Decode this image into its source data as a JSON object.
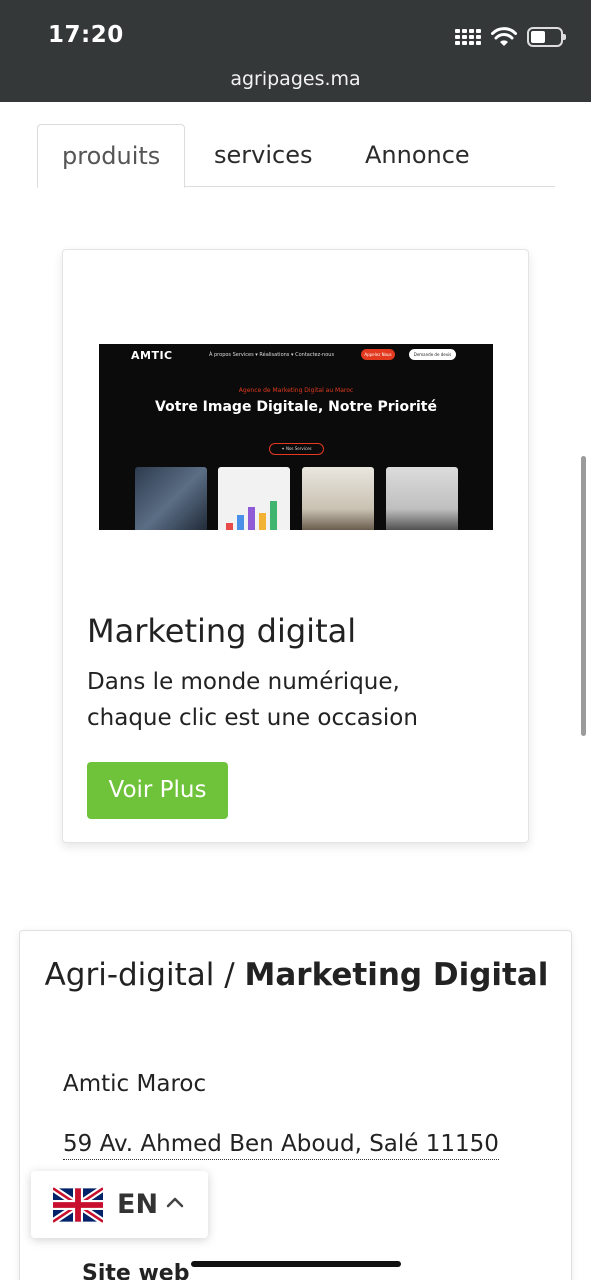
{
  "status_bar": {
    "time": "17:20",
    "url": "agripages.ma"
  },
  "tabs": [
    {
      "label": "produits",
      "active": true
    },
    {
      "label": "services",
      "active": false
    },
    {
      "label": "Annonce",
      "active": false
    }
  ],
  "product_card": {
    "thumbnail": {
      "logo": "AMTIC",
      "nav": "À propos   Services ▾   Réalisations ▾   Contactez-nous",
      "btn_call": "Appelez Nous",
      "btn_quote": "Demande de devis",
      "kicker": "Agence de Marketing Digital au Maroc",
      "headline": "Votre Image Digitale, Notre Priorité",
      "cta": "✦ Nos Services"
    },
    "title": "Marketing digital",
    "description": "Dans le monde numérique, chaque clic est une occasion",
    "button_label": "Voir Plus",
    "button_color": "#6fc33a"
  },
  "info_card": {
    "title_prefix": "Agri-digital / ",
    "title_bold": "Marketing Digital",
    "company": "Amtic Maroc",
    "address": "59 Av. Ahmed Ben Aboud, Salé 11150",
    "partial_text": "e",
    "site_label": "Site web"
  },
  "language_selector": {
    "code": "EN",
    "flag_icon": "uk-flag-icon",
    "chevron_icon": "chevron-up-icon"
  }
}
